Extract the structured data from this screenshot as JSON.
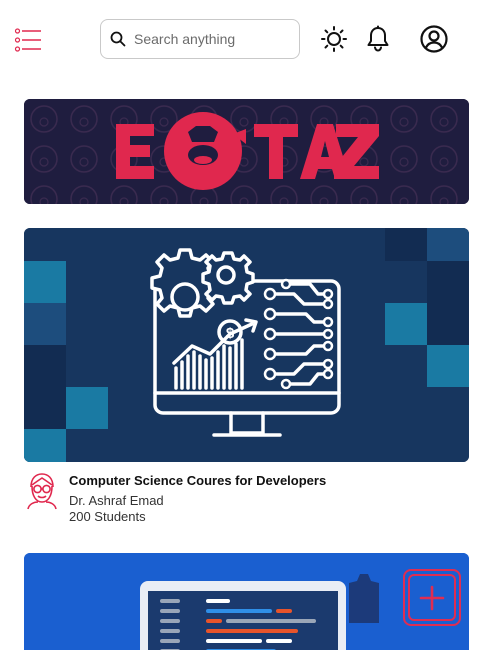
{
  "header": {
    "menu_icon": "hamburger-menu-icon",
    "search": {
      "placeholder": "Search anything",
      "value": "",
      "icon": "search-icon"
    },
    "theme_icon": "sun-icon",
    "notifications_icon": "bell-icon",
    "profile_icon": "user-circle-icon"
  },
  "banner": {
    "logo_text": "EOTAZ",
    "logo_color": "#e0284e",
    "background": "#1f1d3f"
  },
  "course": {
    "title": "Computer Science Coures for Developers",
    "author": "Dr. Ashraf Emad",
    "students": "200 Students",
    "avatar_icon": "teacher-avatar-icon",
    "image_icon": "computer-gears-chart-icon"
  },
  "card2": {
    "image_icon": "code-editor-icon"
  },
  "fab": {
    "icon": "plus-icon",
    "accent": "#e02d52"
  },
  "colors": {
    "accent": "#e0284e",
    "navy": "#17365f",
    "blue": "#1a5fd0"
  }
}
